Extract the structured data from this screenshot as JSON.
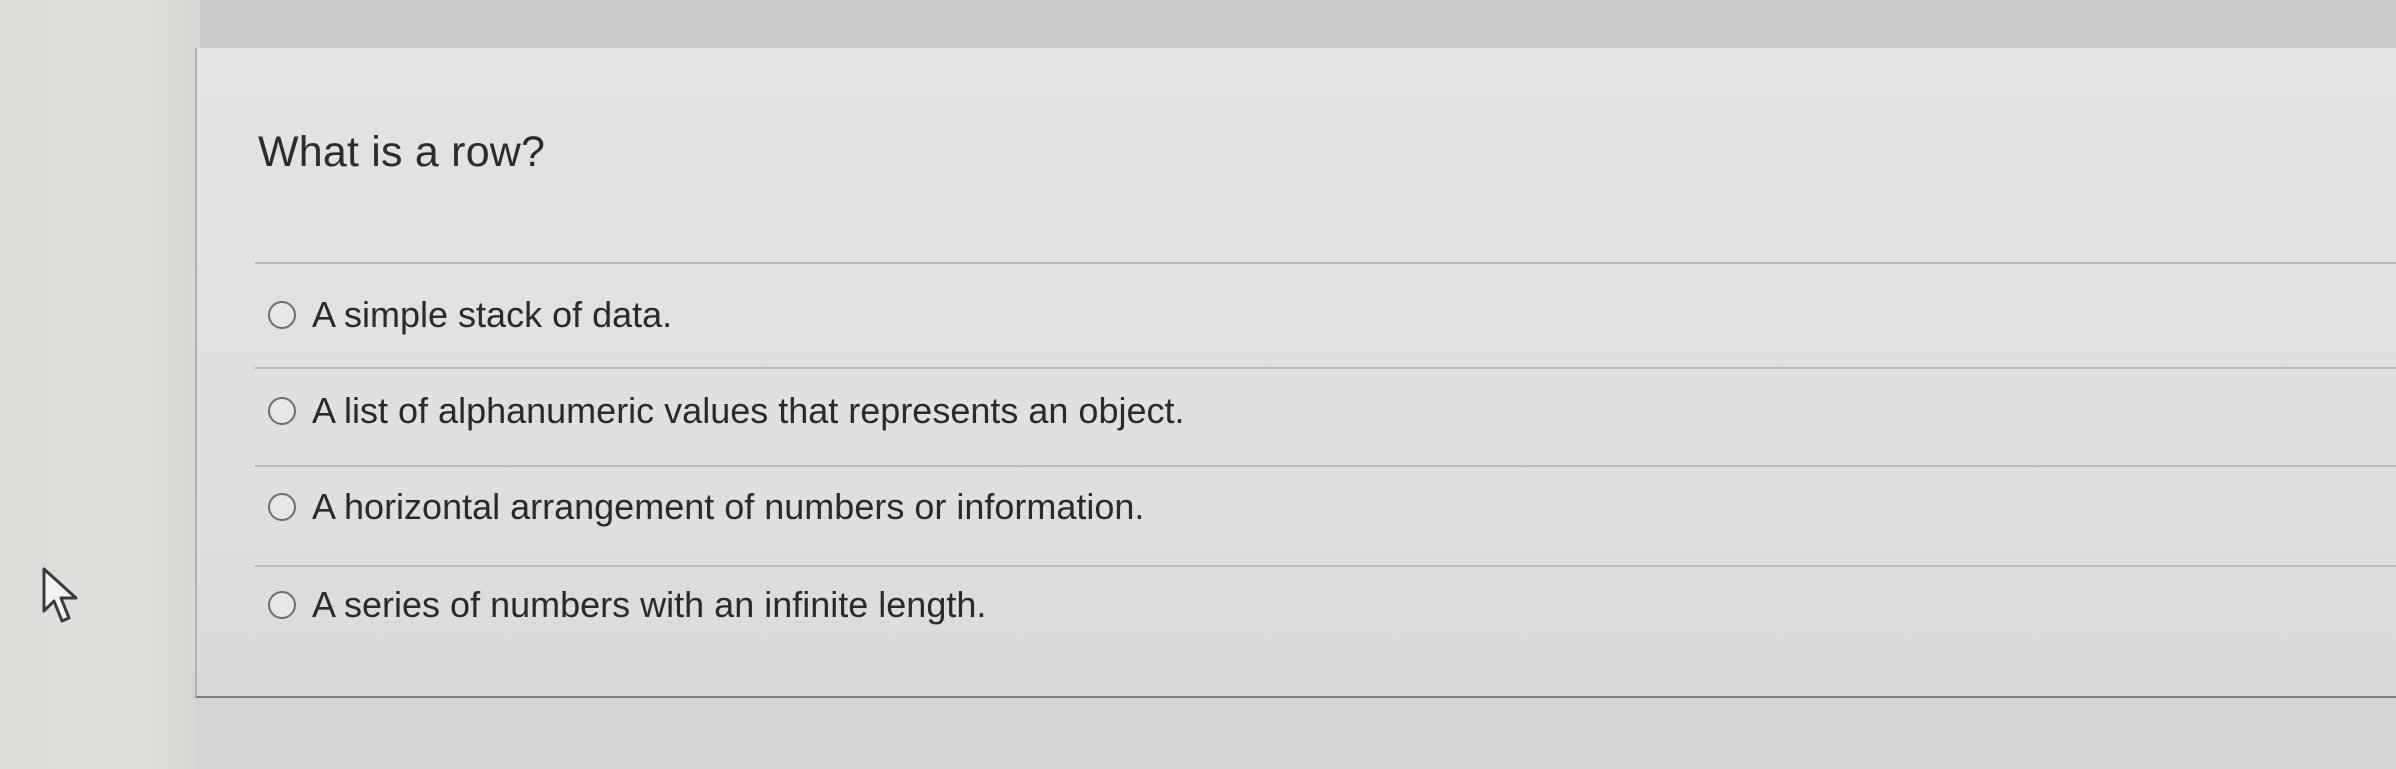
{
  "question": {
    "text": "What is a row?"
  },
  "options": [
    {
      "label": "A simple stack of data.",
      "selected": false
    },
    {
      "label": "A list of alphanumeric values that represents an object.",
      "selected": false
    },
    {
      "label": "A horizontal arrangement of numbers or information.",
      "selected": false
    },
    {
      "label": "A series of numbers with an infinite length.",
      "selected": false
    }
  ],
  "icons": {
    "cursor": "mouse-pointer-icon",
    "radio": "radio-button-icon"
  },
  "colors": {
    "text": "#2c2c2c",
    "radio_border": "#6d6d6d",
    "divider": "#b8b8b8"
  }
}
